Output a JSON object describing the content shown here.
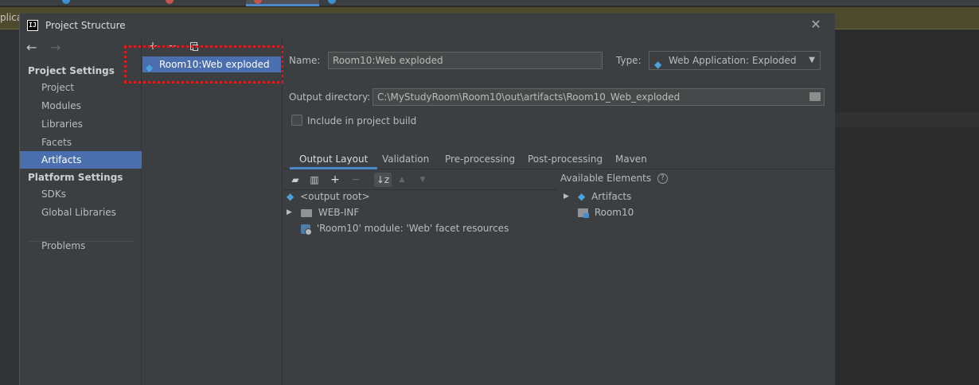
{
  "background_ide": {
    "banner_text": "plicat"
  },
  "dialog": {
    "title": "Project Structure",
    "close_glyph": "✕"
  },
  "nav": {
    "back_glyph": "←",
    "forward_glyph": "→",
    "project_settings_header": "Project Settings",
    "project_settings_items": [
      "Project",
      "Modules",
      "Libraries",
      "Facets",
      "Artifacts"
    ],
    "selected_item": "Artifacts",
    "platform_settings_header": "Platform Settings",
    "platform_settings_items": [
      "SDKs",
      "Global Libraries"
    ],
    "problems_label": "Problems"
  },
  "artifact_list": {
    "toolbar": {
      "add_glyph": "+",
      "remove_glyph": "−"
    },
    "items": [
      "Room10:Web exploded"
    ]
  },
  "editor": {
    "name_label": "Name:",
    "name_value": "Room10:Web exploded",
    "type_label": "Type:",
    "type_value": "Web Application: Exploded",
    "output_dir_label": "Output directory:",
    "output_dir_value": "C:\\MyStudyRoom\\Room10\\out\\artifacts\\Room10_Web_exploded",
    "include_build_label": "Include in project build",
    "include_build_checked": false,
    "tabs": [
      "Output Layout",
      "Validation",
      "Pre-processing",
      "Post-processing",
      "Maven"
    ],
    "active_tab": "Output Layout",
    "layout_toolbar": {
      "add_glyph": "+",
      "remove_glyph": "−",
      "sort_glyph": "↓z",
      "up_glyph": "▲",
      "down_glyph": "▼"
    },
    "output_tree": [
      "<output root>",
      "WEB-INF",
      "'Room10' module: 'Web' facet resources"
    ],
    "available_title": "Available Elements",
    "available_tree": [
      "Artifacts",
      "Room10"
    ]
  },
  "colors": {
    "selection": "#4b6eaf",
    "dialog_bg": "#3c3f41",
    "annotation_dotted_border": "#e01b1b",
    "accent_tab": "#4a88c7"
  },
  "icons": [
    "back-arrow-icon",
    "forward-arrow-icon",
    "add-icon",
    "remove-icon",
    "copy-icon",
    "web-artifact-icon",
    "folder-icon",
    "dropdown-caret-icon",
    "help-icon",
    "sort-icon",
    "move-up-icon",
    "move-down-icon",
    "close-icon"
  ]
}
